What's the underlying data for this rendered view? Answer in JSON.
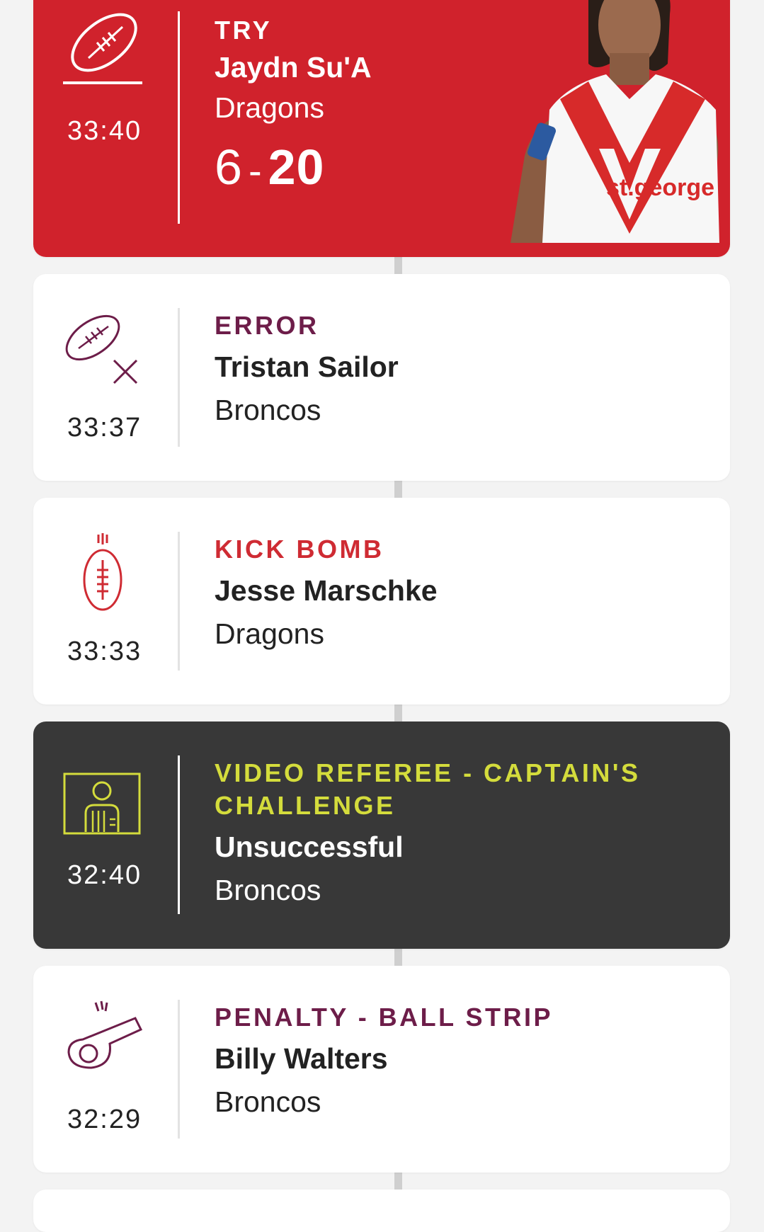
{
  "events": [
    {
      "kind": "try",
      "time": "33:40",
      "type_label": "TRY",
      "player": "Jaydn Su'A",
      "team": "Dragons",
      "score_home": "6",
      "score_sep": "-",
      "score_away": "20",
      "icon": "rugby-ball-try-icon",
      "card_color": "#d0222c"
    },
    {
      "kind": "error",
      "time": "33:37",
      "type_label": "ERROR",
      "player": "Tristan Sailor",
      "team": "Broncos",
      "icon": "ball-error-icon"
    },
    {
      "kind": "kick",
      "time": "33:33",
      "type_label": "KICK BOMB",
      "player": "Jesse Marschke",
      "team": "Dragons",
      "icon": "kick-bomb-icon"
    },
    {
      "kind": "video-ref",
      "time": "32:40",
      "type_label_line1": "VIDEO REFEREE - CAPTAIN'S",
      "type_label_line2": "CHALLENGE",
      "player": "Unsuccessful",
      "team": "Broncos",
      "icon": "video-referee-icon",
      "card_color": "#383838",
      "accent": "#d4dc3c"
    },
    {
      "kind": "penalty",
      "time": "32:29",
      "type_label": "PENALTY - BALL STRIP",
      "player": "Billy Walters",
      "team": "Broncos",
      "icon": "whistle-icon"
    }
  ],
  "sponsor_text": "st.george"
}
